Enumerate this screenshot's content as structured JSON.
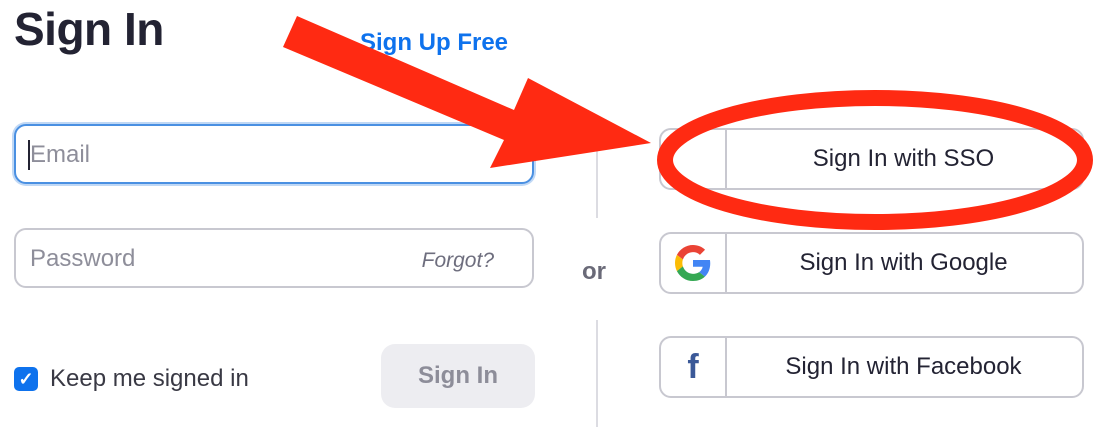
{
  "header": {
    "title": "Sign In",
    "signup_link": "Sign Up Free"
  },
  "form": {
    "email": {
      "placeholder": "Email"
    },
    "password": {
      "placeholder": "Password",
      "forgot_link": "Forgot?"
    },
    "keep_signed_in": {
      "label": "Keep me signed in",
      "checked": true
    },
    "submit_label": "Sign In"
  },
  "divider": {
    "or_text": "or"
  },
  "alt_signin": [
    {
      "label": "Sign In with SSO",
      "icon": "key-icon"
    },
    {
      "label": "Sign In with Google",
      "icon": "google-icon"
    },
    {
      "label": "Sign In with Facebook",
      "icon": "facebook-icon"
    }
  ],
  "annotation": {
    "arrow_color": "#ff2a12",
    "ellipse_color": "#ff2a12",
    "target": "Sign In with SSO"
  },
  "colors": {
    "accent": "#0e72ed",
    "focus_border": "#4a90e2"
  }
}
